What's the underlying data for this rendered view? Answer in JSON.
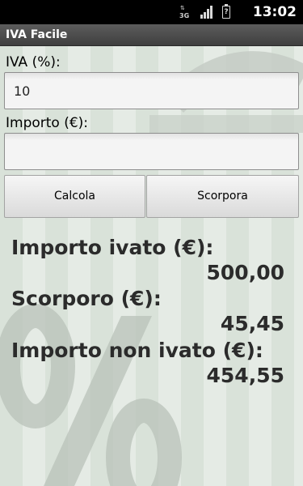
{
  "status_bar": {
    "network_type": "3G",
    "time": "13:02"
  },
  "app": {
    "title": "IVA Facile"
  },
  "form": {
    "iva_label": "IVA (%):",
    "iva_value": "10",
    "importo_label": "Importo (€):",
    "importo_value": ""
  },
  "buttons": {
    "calcola": "Calcola",
    "scorpora": "Scorpora"
  },
  "results": {
    "importo_ivato_label": "Importo ivato (€):",
    "importo_ivato_value": "500,00",
    "scorporo_label": "Scorporo (€):",
    "scorporo_value": "45,45",
    "importo_non_ivato_label": "Importo non ivato (€):",
    "importo_non_ivato_value": "454,55"
  },
  "icons": {
    "network": "network-3g-icon",
    "signal": "signal-strength-icon",
    "battery": "battery-unknown-icon",
    "background": "percent-watermark-icon"
  },
  "colors": {
    "status_bar": "#000000",
    "title_bar": "#4a4a4a",
    "background_light": "#e5ebe5",
    "background_dark": "#d9e2d9",
    "result_text": "#2b2b2b"
  }
}
